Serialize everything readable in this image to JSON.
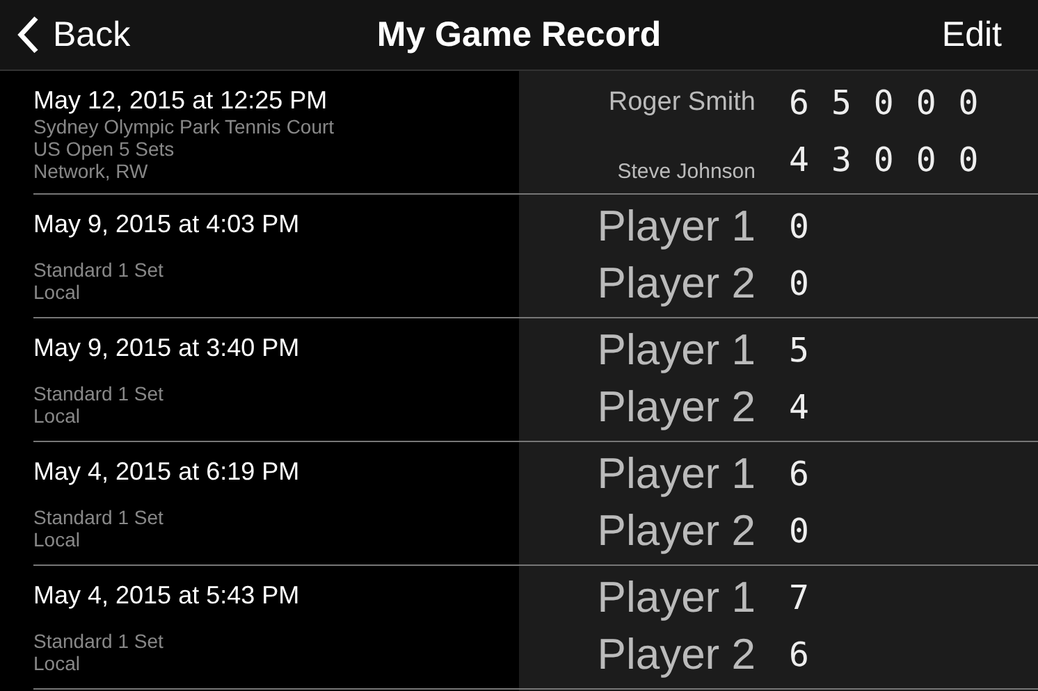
{
  "nav": {
    "back": "Back",
    "title": "My Game Record",
    "edit": "Edit"
  },
  "games": [
    {
      "kind": "named",
      "date": "May 12, 2015 at 12:25 PM",
      "details": [
        "Sydney Olympic Park Tennis Court",
        "US Open 5 Sets",
        "Network, RW"
      ],
      "players": [
        {
          "name": "Roger Smith",
          "score": "65000"
        },
        {
          "name": "Steve Johnson",
          "score": "43000"
        }
      ]
    },
    {
      "kind": "plain",
      "date": "May 9, 2015 at 4:03 PM",
      "details": [
        "Standard 1 Set",
        "Local"
      ],
      "players": [
        {
          "name": "Player 1",
          "score": "0"
        },
        {
          "name": "Player 2",
          "score": "0"
        }
      ]
    },
    {
      "kind": "plain",
      "date": "May 9, 2015 at 3:40 PM",
      "details": [
        "Standard 1 Set",
        "Local"
      ],
      "players": [
        {
          "name": "Player 1",
          "score": "5"
        },
        {
          "name": "Player 2",
          "score": "4"
        }
      ]
    },
    {
      "kind": "plain",
      "date": "May 4, 2015 at 6:19 PM",
      "details": [
        "Standard 1 Set",
        "Local"
      ],
      "players": [
        {
          "name": "Player 1",
          "score": "6"
        },
        {
          "name": "Player 2",
          "score": "0"
        }
      ]
    },
    {
      "kind": "plain",
      "date": "May 4, 2015 at 5:43 PM",
      "details": [
        "Standard 1 Set",
        "Local"
      ],
      "players": [
        {
          "name": "Player 1",
          "score": "7"
        },
        {
          "name": "Player 2",
          "score": "6"
        }
      ]
    }
  ]
}
